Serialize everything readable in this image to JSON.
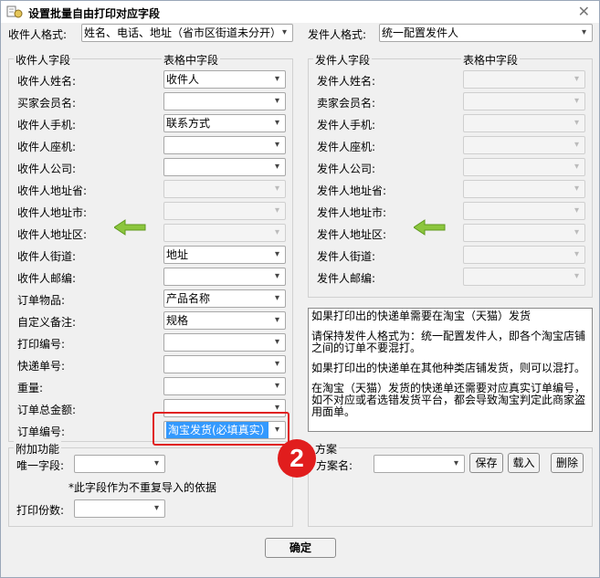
{
  "window": {
    "title": "设置批量自由打印对应字段"
  },
  "top": {
    "recipient_format_label": "收件人格式:",
    "recipient_format_value": "姓名、电话、地址（省市区街道未分开）",
    "sender_format_label": "发件人格式:",
    "sender_format_value": "统一配置发件人"
  },
  "left": {
    "group_title": "收件人字段",
    "table_col_title": "表格中字段",
    "rows": [
      {
        "label": "收件人姓名:",
        "value": "收件人",
        "disabled": false
      },
      {
        "label": "买家会员名:",
        "value": "",
        "disabled": false
      },
      {
        "label": "收件人手机:",
        "value": "联系方式",
        "disabled": false
      },
      {
        "label": "收件人座机:",
        "value": "",
        "disabled": false
      },
      {
        "label": "收件人公司:",
        "value": "",
        "disabled": false
      },
      {
        "label": "收件人地址省:",
        "value": "",
        "disabled": true
      },
      {
        "label": "收件人地址市:",
        "value": "",
        "disabled": true
      },
      {
        "label": "收件人地址区:",
        "value": "",
        "disabled": true
      },
      {
        "label": "收件人街道:",
        "value": "地址",
        "disabled": false
      },
      {
        "label": "收件人邮编:",
        "value": "",
        "disabled": false
      },
      {
        "label": "订单物品:",
        "value": "产品名称",
        "disabled": false
      },
      {
        "label": "自定义备注:",
        "value": "规格",
        "disabled": false
      },
      {
        "label": "打印编号:",
        "value": "",
        "disabled": false
      },
      {
        "label": "快递单号:",
        "value": "",
        "disabled": false
      },
      {
        "label": "重量:",
        "value": "",
        "disabled": false
      },
      {
        "label": "订单总金额:",
        "value": "",
        "disabled": false
      },
      {
        "label": "订单编号:",
        "value": "淘宝发货(必填真实）",
        "disabled": false,
        "highlight": true
      }
    ]
  },
  "right": {
    "group_title": "发件人字段",
    "table_col_title": "表格中字段",
    "rows": [
      {
        "label": "发件人姓名:"
      },
      {
        "label": "卖家会员名:"
      },
      {
        "label": "发件人手机:"
      },
      {
        "label": "发件人座机:"
      },
      {
        "label": "发件人公司:"
      },
      {
        "label": "发件人地址省:"
      },
      {
        "label": "发件人地址市:"
      },
      {
        "label": "发件人地址区:"
      },
      {
        "label": "发件人街道:"
      },
      {
        "label": "发件人邮编:"
      }
    ]
  },
  "info": {
    "p1": "如果打印出的快递单需要在淘宝（天猫）发货",
    "p2": "请保持发件人格式为：统一配置发件人，即各个淘宝店铺之间的订单不要混打。",
    "p3": "如果打印出的快递单在其他种类店铺发货，则可以混打。",
    "p4": "在淘宝（天猫）发货的快递单还需要对应真实订单编号，如不对应或者选错发货平台，都会导致淘宝判定此商家盗用面单。"
  },
  "extra": {
    "group_title": "附加功能",
    "unique_label": "唯一字段:",
    "unique_value": "",
    "note": "*此字段作为不重复导入的依据",
    "copies_label": "打印份数:",
    "copies_value": ""
  },
  "plan": {
    "group_title": "方案",
    "name_label": "方案名:",
    "name_value": "",
    "save": "保存",
    "load": "载入",
    "delete": "删除"
  },
  "annotation": {
    "step": "2",
    "color": "#e11d1d"
  },
  "footer": {
    "ok": "确定"
  }
}
